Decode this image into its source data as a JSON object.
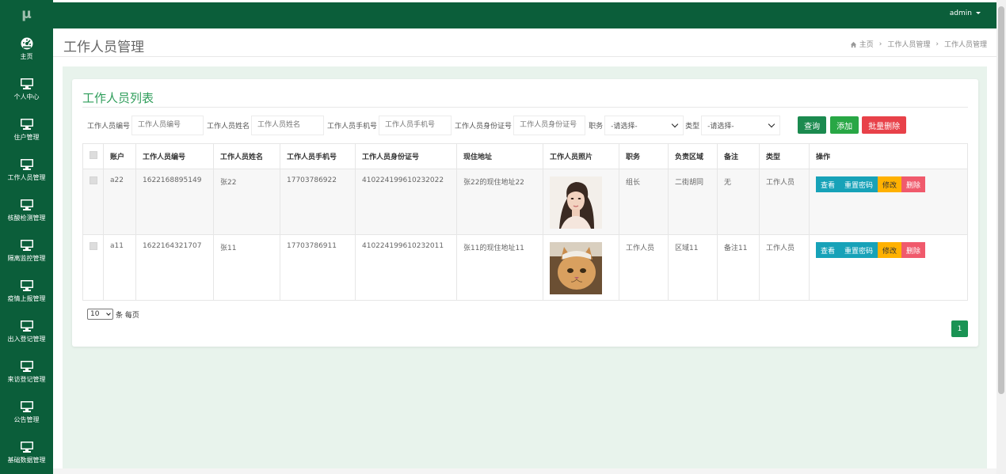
{
  "logo": "μ",
  "sidebar": {
    "items": [
      {
        "label": "主页",
        "icon": "dashboard-icon"
      },
      {
        "label": "个人中心",
        "icon": "monitor-icon"
      },
      {
        "label": "住户管理",
        "icon": "monitor-icon"
      },
      {
        "label": "工作人员管理",
        "icon": "monitor-icon"
      },
      {
        "label": "核酸检测管理",
        "icon": "monitor-icon"
      },
      {
        "label": "隔离监控管理",
        "icon": "monitor-icon"
      },
      {
        "label": "疫情上报管理",
        "icon": "monitor-icon"
      },
      {
        "label": "出入登记管理",
        "icon": "monitor-icon"
      },
      {
        "label": "来访登记管理",
        "icon": "monitor-icon"
      },
      {
        "label": "公告管理",
        "icon": "monitor-icon"
      },
      {
        "label": "基础数据管理",
        "icon": "monitor-icon"
      }
    ]
  },
  "header": {
    "user": "admin"
  },
  "page": {
    "title": "工作人员管理",
    "breadcrumb": [
      "主页",
      "工作人员管理",
      "工作人员管理"
    ]
  },
  "card": {
    "title": "工作人员列表"
  },
  "search": {
    "fields": [
      {
        "label": "工作人员编号",
        "placeholder": "工作人员编号"
      },
      {
        "label": "工作人员姓名",
        "placeholder": "工作人员姓名"
      },
      {
        "label": "工作人员手机号",
        "placeholder": "工作人员手机号"
      },
      {
        "label": "工作人员身份证号",
        "placeholder": "工作人员身份证号"
      }
    ],
    "position_label": "职务",
    "position_value": "-请选择-",
    "type_label": "类型",
    "type_value": "-请选择-",
    "query_label": "查询",
    "add_label": "添加",
    "batch_delete_label": "批量删除"
  },
  "table": {
    "headers": [
      "",
      "账户",
      "工作人员编号",
      "工作人员姓名",
      "工作人员手机号",
      "工作人员身份证号",
      "现住地址",
      "工作人员照片",
      "职务",
      "负责区域",
      "备注",
      "类型",
      "操作"
    ],
    "rows": [
      {
        "account": "a22",
        "number": "1622168895149",
        "name": "张22",
        "phone": "17703786922",
        "idcard": "410224199610232022",
        "address": "张22的现住地址22",
        "photo": "woman-portrait",
        "position": "组长",
        "area": "二街胡同",
        "remark": "无",
        "type": "工作人员"
      },
      {
        "account": "a11",
        "number": "1622164321707",
        "name": "张11",
        "phone": "17703786911",
        "idcard": "410224199610232011",
        "address": "张11的现住地址11",
        "photo": "cat-photo",
        "position": "工作人员",
        "area": "区域11",
        "remark": "备注11",
        "type": "工作人员"
      }
    ],
    "ops": {
      "view": "查看",
      "reset": "重置密码",
      "edit": "修改",
      "delete": "删除"
    }
  },
  "pagination": {
    "page_size": "10",
    "per_page_label": "条 每页",
    "current_page": "1"
  },
  "colors": {
    "sidebar": "#0b5e3a",
    "accent": "#2e9d5a",
    "main_bg": "#e8f3ec"
  }
}
